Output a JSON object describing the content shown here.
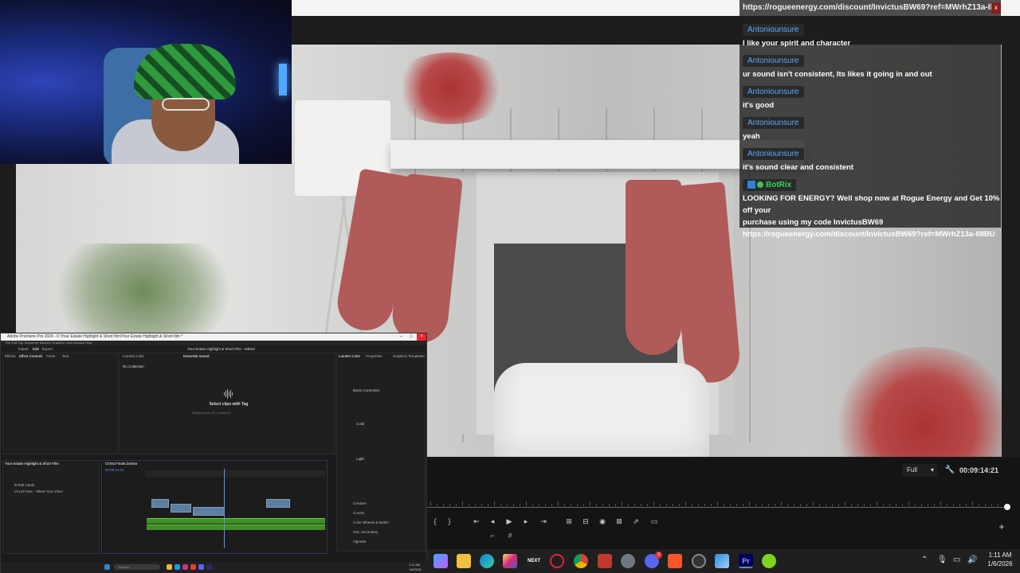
{
  "chat": {
    "top_url": "https://rogueenergy.com/discount/InvictusBW69?ref=MWrhZ13a-Il8BU",
    "close_label": "x",
    "messages": [
      {
        "user": "Antoniounsure",
        "text": "I like your spirit and character"
      },
      {
        "user": "Antoniounsure",
        "text": "ur sound isn't consistent, Its likes it going in and out"
      },
      {
        "user": "Antoniounsure",
        "text": "it's good"
      },
      {
        "user": "Antoniounsure",
        "text": "yeah"
      },
      {
        "user": "Antoniounsure",
        "text": "it's sound clear and consistent"
      }
    ],
    "bot": {
      "user": "BotRix",
      "line1": "LOOKING FOR ENERGY? Well shop now at Rogue Energy and Get 10% off your",
      "line2": "purchase using my code InvictusBW69",
      "line3": "https://rogueenergy.com/discount/InvictusBW69?ref=MWrhZ13a-Il8BU"
    },
    "colors": {
      "username": "#5aaaff",
      "bot_username": "#36d45a"
    }
  },
  "player": {
    "quality": "Full",
    "timecode": "00:09:14:21",
    "progress": 1.0
  },
  "premiere": {
    "title": "Adobe Premiere Pro 2024 - F:\\Your Estate Highlight & Short film\\Your Estate Highlight & Short film *",
    "menu": "File  Edit  Clip  Sequence  Markers  Graphics  View  Window  Help",
    "tabs": {
      "import": "Import",
      "edit": "Edit",
      "export": "Export",
      "project_name": "Your Estate Highlight & Short Film - Edited",
      "effects": "Effects",
      "effect_controls": "Effect Controls",
      "fonts": "Fonts",
      "text": "Text",
      "lumetri": "Lumetri Color",
      "essential_sound": "Essential Sound",
      "properties": "Properties",
      "graphics_templates": "Graphics Templates",
      "libraries": "Libraries",
      "no_collection": "No Collection"
    },
    "select_clips_title": "Select clips with Tag",
    "select_clips_options": "Dialogue   Music   SFX   Ambience",
    "panel_labels": {
      "basic_correction": "Basic Correction",
      "creative": "Creative",
      "curves": "Curves",
      "color_wheels": "Color Wheels & Match",
      "hsl_secondary": "HSL Secondary",
      "vignette": "Vignette",
      "color": "Color",
      "light": "Light"
    },
    "timeline_tab": "Your Estate Highlight & Short Film",
    "sequence_tab": "Christ.Finale.Drama",
    "timecode": "00:09:14:21",
    "bins": [
      "B-Roll Cards",
      "Lil Let Here - Silent Your Voice"
    ],
    "status": "Click to select, or click in empty space and drag to marquee select. Use Shift, Alt, and Ctrl for other options.",
    "search_placeholder": "Search",
    "small_clock": "1:11 AM",
    "small_date": "1/6/2026"
  },
  "taskbar": {
    "time": "1:11 AM",
    "date": "1/6/2026",
    "discord_badge": "3",
    "icons": [
      "copilot-icon",
      "file-explorer-icon",
      "edge-icon",
      "instagram-icon",
      "next-icon",
      "opera-icon",
      "chrome-icon",
      "news-icon",
      "settings-icon",
      "discord-icon",
      "brave-icon",
      "obs-icon",
      "photos-icon",
      "premiere-icon",
      "xbox-icon"
    ],
    "icon_labels": {
      "next": "NEXT",
      "premiere": "Pr"
    }
  }
}
